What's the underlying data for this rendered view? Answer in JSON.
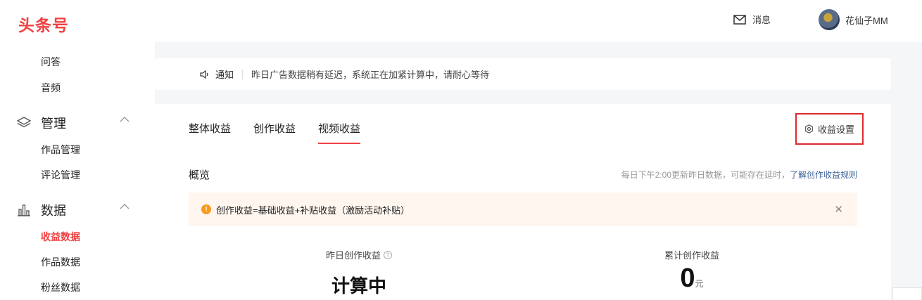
{
  "header": {
    "logo": "头条号",
    "messages_label": "消息",
    "username": "花仙子MM"
  },
  "sidebar": {
    "top_items": [
      {
        "label": "问答"
      },
      {
        "label": "音频"
      }
    ],
    "groups": [
      {
        "label": "管理",
        "icon": "layers-icon",
        "items": [
          {
            "label": "作品管理"
          },
          {
            "label": "评论管理"
          }
        ]
      },
      {
        "label": "数据",
        "icon": "bar-chart-icon",
        "items": [
          {
            "label": "收益数据",
            "active": true
          },
          {
            "label": "作品数据"
          },
          {
            "label": "粉丝数据"
          }
        ]
      }
    ]
  },
  "notice": {
    "title": "通知",
    "text": "昨日广告数据稍有延迟，系统正在加紧计算中，请耐心等待"
  },
  "main": {
    "tabs": [
      {
        "label": "整体收益",
        "active": false
      },
      {
        "label": "创作收益",
        "active": false
      },
      {
        "label": "视频收益",
        "active": true
      }
    ],
    "settings_label": "收益设置",
    "overview_label": "概览",
    "update_text": "每日下午2:00更新昨日数据，可能存在延时，",
    "update_link": "了解创作收益规则",
    "alert_text": "创作收益=基础收益+补贴收益（激励活动补贴）",
    "stats": [
      {
        "label": "昨日创作收益",
        "value": "计算中"
      },
      {
        "label": "累计创作收益",
        "value": "0",
        "unit": "元"
      }
    ]
  },
  "colors": {
    "accent": "#f04142",
    "highlight_box": "#e0292d",
    "alert_bg": "#fff6f0",
    "alert_icon": "#f79a1e",
    "link": "#406599"
  }
}
